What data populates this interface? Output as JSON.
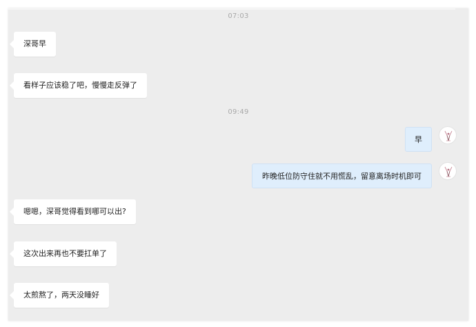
{
  "timestamps": [
    "07:03",
    "09:49"
  ],
  "messages": [
    {
      "text": "深哥早",
      "direction": "incoming"
    },
    {
      "text": "看样子应该稳了吧，慢慢走反弹了",
      "direction": "incoming"
    },
    {
      "text": "早",
      "direction": "outgoing"
    },
    {
      "text": "昨晚低位防守住就不用慌乱，留意离场时机即可",
      "direction": "outgoing"
    },
    {
      "text": "嗯嗯，深哥觉得看到哪可以出?",
      "direction": "incoming"
    },
    {
      "text": "这次出来再也不要扛单了",
      "direction": "incoming"
    },
    {
      "text": "太煎熬了，两天没睡好",
      "direction": "incoming"
    }
  ],
  "avatar_icon": "user-avatar-icon",
  "colors": {
    "chat_background": "#ededed",
    "incoming_bubble": "#ffffff",
    "outgoing_bubble": "#dfeefc",
    "timestamp_text": "#a8a8a8"
  }
}
